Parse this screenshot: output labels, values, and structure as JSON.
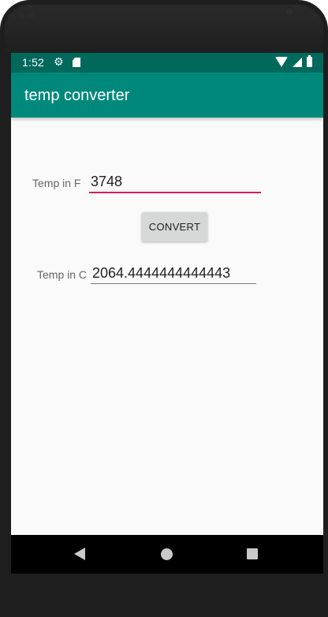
{
  "status_bar": {
    "time": "1:52",
    "icons": [
      "gear-icon",
      "sd-card-icon",
      "wifi-icon",
      "cell-signal-icon",
      "battery-icon"
    ]
  },
  "app_bar": {
    "title": "temp converter",
    "color": "#00897b",
    "status_color": "#00695c"
  },
  "form": {
    "fahrenheit_label": "Temp in F",
    "fahrenheit_value": "3748",
    "convert_label": "CONVERT",
    "celsius_label": "Temp in C",
    "celsius_value": "2064.4444444444443",
    "accent_color": "#d81b60"
  },
  "navigation": {
    "icons": [
      "back-icon",
      "home-icon",
      "recents-icon"
    ]
  }
}
